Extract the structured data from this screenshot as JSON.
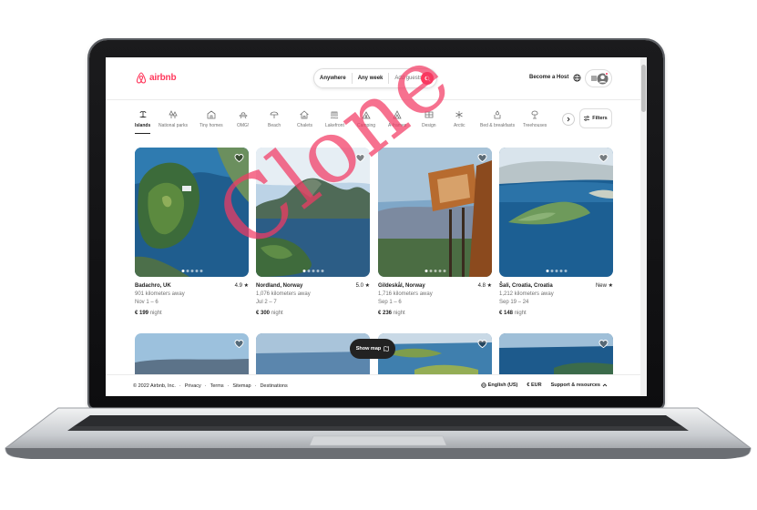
{
  "brand": {
    "name": "airbnb",
    "color": "#ff385c"
  },
  "search": {
    "anywhere": "Anywhere",
    "any_week": "Any week",
    "add_guests": "Add guests",
    "icon": "search-icon"
  },
  "header": {
    "become_host": "Become a Host",
    "globe_icon": "globe-icon",
    "menu_icon": "hamburger-icon",
    "avatar_icon": "user-icon"
  },
  "categories": [
    {
      "label": "Islands",
      "icon": "island-icon",
      "active": true
    },
    {
      "label": "National parks",
      "icon": "tree-icon"
    },
    {
      "label": "Tiny homes",
      "icon": "tiny-home-icon"
    },
    {
      "label": "OMG!",
      "icon": "ufo-icon"
    },
    {
      "label": "Beach",
      "icon": "umbrella-icon"
    },
    {
      "label": "Chalets",
      "icon": "chalet-icon"
    },
    {
      "label": "Lakefront",
      "icon": "lakefront-icon"
    },
    {
      "label": "Camping",
      "icon": "tent-icon"
    },
    {
      "label": "A-frames",
      "icon": "a-frame-icon"
    },
    {
      "label": "Design",
      "icon": "design-icon"
    },
    {
      "label": "Arctic",
      "icon": "snowflake-icon"
    },
    {
      "label": "Bed & breakfasts",
      "icon": "bed-breakfast-icon"
    },
    {
      "label": "Treehouses",
      "icon": "treehouse-icon"
    }
  ],
  "filters_label": "Filters",
  "listings": [
    {
      "location": "Badachro, UK",
      "rating": "4.9 ★",
      "distance": "901 kilometers away",
      "dates": "Nov 1 – 6",
      "price": "€ 199",
      "per": "night"
    },
    {
      "location": "Nordland, Norway",
      "rating": "5.0 ★",
      "distance": "1,076 kilometers away",
      "dates": "Jul 2 – 7",
      "price": "€ 300",
      "per": "night"
    },
    {
      "location": "Gildeskål, Norway",
      "rating": "4.8 ★",
      "distance": "1,716 kilometers away",
      "dates": "Sep 1 – 6",
      "price": "€ 236",
      "per": "night"
    },
    {
      "location": "Šali, Croatia, Croatia",
      "rating": "New ★",
      "distance": "1,212 kilometers away",
      "dates": "Sep 19 – 24",
      "price": "€ 148",
      "per": "night"
    }
  ],
  "show_map": "Show map",
  "footer": {
    "copyright": "© 2022 Airbnb, Inc.",
    "links": [
      "Privacy",
      "Terms",
      "Sitemap",
      "Destinations"
    ],
    "separator": "·",
    "language": "English (US)",
    "currency": "€ EUR",
    "support": "Support & resources"
  },
  "watermark": "Clone"
}
